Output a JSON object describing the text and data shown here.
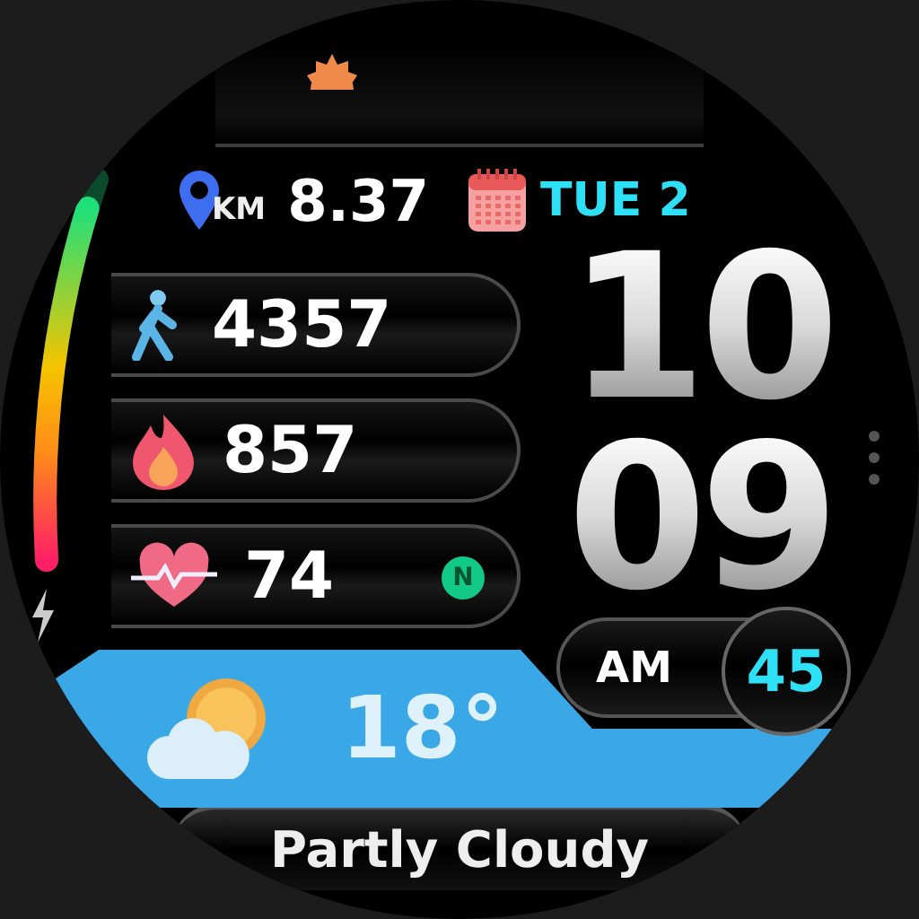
{
  "battery": {
    "level": 0.92
  },
  "distance": {
    "unit": "KM",
    "value": "8.37"
  },
  "date": {
    "text": "TUE 2"
  },
  "stats": [
    {
      "kind": "steps",
      "value": "4357"
    },
    {
      "kind": "calories",
      "value": "857"
    },
    {
      "kind": "heart_rate",
      "value": "74",
      "badge": "N"
    }
  ],
  "time": {
    "hours": "10",
    "minutes": "09",
    "period": "AM",
    "seconds": "45"
  },
  "weather": {
    "temperature": "18°",
    "condition": "Partly Cloudy"
  }
}
